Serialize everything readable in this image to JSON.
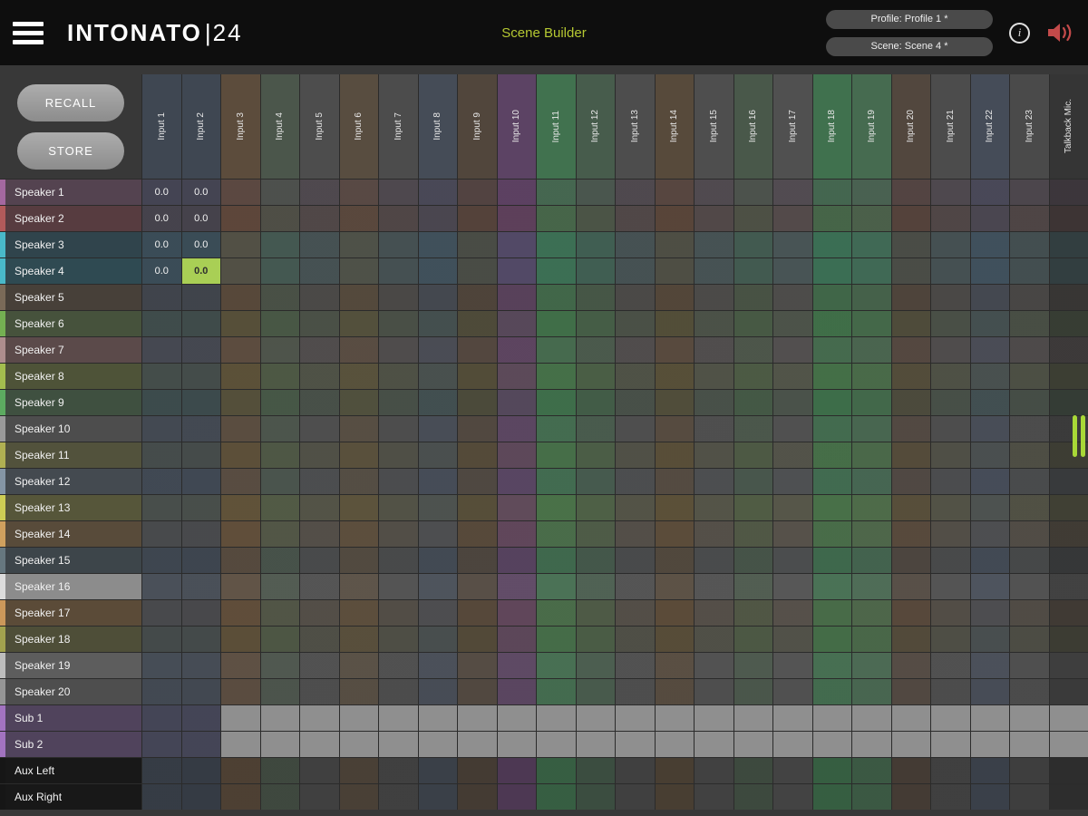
{
  "header": {
    "logo_main": "INTONATO",
    "logo_sub": "|24",
    "title": "Scene Builder",
    "profile_button": "Profile: Profile 1 *",
    "scene_button": "Scene: Scene 4 *"
  },
  "icons": {
    "info_glyph": "i"
  },
  "colors": {
    "accent": "#b5c832",
    "selected_cell": "#a9cf55",
    "drawer_handle": "#a8d837",
    "mute_red": "#c34a4a",
    "disabled_cell": "#8f8f8f"
  },
  "matrix": {
    "recall_label": "RECALL",
    "store_label": "STORE",
    "columns": [
      {
        "label": "Input 1",
        "color": "#3f4752"
      },
      {
        "label": "Input 2",
        "color": "#3f4752"
      },
      {
        "label": "Input 3",
        "color": "#5c4c3c"
      },
      {
        "label": "Input 4",
        "color": "#4b564b"
      },
      {
        "label": "Input 5",
        "color": "#4d4d4d"
      },
      {
        "label": "Input 6",
        "color": "#584d40"
      },
      {
        "label": "Input 7",
        "color": "#4c4c4c"
      },
      {
        "label": "Input 8",
        "color": "#454c57"
      },
      {
        "label": "Input 9",
        "color": "#51463c"
      },
      {
        "label": "Input 10",
        "color": "#5c4364"
      },
      {
        "label": "Input 11",
        "color": "#41724f"
      },
      {
        "label": "Input 12",
        "color": "#475c4c"
      },
      {
        "label": "Input 13",
        "color": "#4d4d4d"
      },
      {
        "label": "Input 14",
        "color": "#574a3b"
      },
      {
        "label": "Input 15",
        "color": "#4e4e4e"
      },
      {
        "label": "Input 16",
        "color": "#49584a"
      },
      {
        "label": "Input 17",
        "color": "#505050"
      },
      {
        "label": "Input 18",
        "color": "#40714e"
      },
      {
        "label": "Input 19",
        "color": "#466b50"
      },
      {
        "label": "Input 20",
        "color": "#52473e"
      },
      {
        "label": "Input 21",
        "color": "#4c4c4c"
      },
      {
        "label": "Input 22",
        "color": "#454c58"
      },
      {
        "label": "Input 23",
        "color": "#4a4a4a"
      },
      {
        "label": "Talkback Mic.",
        "color": "#353535"
      }
    ],
    "rows": [
      {
        "label": "Speaker 1",
        "strip": "#a468a0",
        "bg": "#544350"
      },
      {
        "label": "Speaker 2",
        "strip": "#b25a5a",
        "bg": "#573c40"
      },
      {
        "label": "Speaker 3",
        "strip": "#49b9c9",
        "bg": "#30444c"
      },
      {
        "label": "Speaker 4",
        "strip": "#49b9c9",
        "bg": "#2f4a52"
      },
      {
        "label": "Speaker 5",
        "strip": "#7a6a58",
        "bg": "#474039"
      },
      {
        "label": "Speaker 6",
        "strip": "#74b052",
        "bg": "#46523c"
      },
      {
        "label": "Speaker 7",
        "strip": "#ad8d8d",
        "bg": "#5b4a4a"
      },
      {
        "label": "Speaker 8",
        "strip": "#a3bd4e",
        "bg": "#4e5338"
      },
      {
        "label": "Speaker 9",
        "strip": "#5cab60",
        "bg": "#3f5040"
      },
      {
        "label": "Speaker 10",
        "strip": "#9a9a9a",
        "bg": "#4d4d4d"
      },
      {
        "label": "Speaker 11",
        "strip": "#b0b052",
        "bg": "#52523c"
      },
      {
        "label": "Speaker 12",
        "strip": "#8495a5",
        "bg": "#444a50"
      },
      {
        "label": "Speaker 13",
        "strip": "#cdcd54",
        "bg": "#56563a"
      },
      {
        "label": "Speaker 14",
        "strip": "#cfa05e",
        "bg": "#584b3a"
      },
      {
        "label": "Speaker 15",
        "strip": "#66777f",
        "bg": "#3d454a"
      },
      {
        "label": "Speaker 16",
        "strip": "#dcdcdc",
        "bg": "#8c8c8c"
      },
      {
        "label": "Speaker 17",
        "strip": "#cc985a",
        "bg": "#5b4b38"
      },
      {
        "label": "Speaker 18",
        "strip": "#a2a24e",
        "bg": "#4e4e38"
      },
      {
        "label": "Speaker 19",
        "strip": "#bdbdbd",
        "bg": "#5d5d5d"
      },
      {
        "label": "Speaker 20",
        "strip": "#959595",
        "bg": "#4e4e4e"
      },
      {
        "label": "Sub 1",
        "strip": "#a273c0",
        "bg": "#50435c"
      },
      {
        "label": "Sub 2",
        "strip": "#a273c0",
        "bg": "#50435c"
      },
      {
        "label": "Aux Left",
        "strip": "#161616",
        "bg": "#181818"
      },
      {
        "label": "Aux Right",
        "strip": "#161616",
        "bg": "#181818"
      }
    ],
    "disabled_region": {
      "rows": [
        20,
        21
      ],
      "from_col": 2
    },
    "values": [
      {
        "row": 0,
        "col": 0,
        "value": "0.0"
      },
      {
        "row": 0,
        "col": 1,
        "value": "0.0"
      },
      {
        "row": 1,
        "col": 0,
        "value": "0.0"
      },
      {
        "row": 1,
        "col": 1,
        "value": "0.0"
      },
      {
        "row": 2,
        "col": 0,
        "value": "0.0"
      },
      {
        "row": 2,
        "col": 1,
        "value": "0.0"
      },
      {
        "row": 3,
        "col": 0,
        "value": "0.0"
      },
      {
        "row": 3,
        "col": 1,
        "value": "0.0",
        "selected": true
      }
    ]
  }
}
